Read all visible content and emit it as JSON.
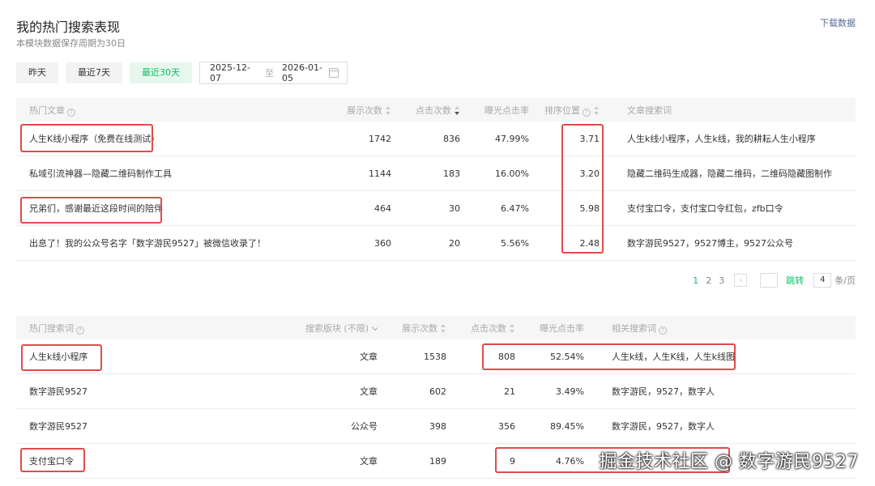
{
  "header": {
    "title": "我的热门搜索表现",
    "subtitle": "本模块数据保存周期为30日",
    "download": "下载数据"
  },
  "filters": {
    "yesterday": "昨天",
    "last7": "最近7天",
    "last30": "最近30天",
    "start_date": "2025-12-07",
    "to": "至",
    "end_date": "2026-01-05"
  },
  "articles_table": {
    "headers": [
      "热门文章",
      "展示次数",
      "点击次数",
      "曝光点击率",
      "排序位置",
      "文章搜索词"
    ],
    "rows": [
      [
        "人生K线小程序（免费在线测试）",
        "1742",
        "836",
        "47.99%",
        "3.71",
        "人生k线小程序，人生k线，我的耕耘人生小程序"
      ],
      [
        "私域引流神器—隐藏二维码制作工具",
        "1144",
        "183",
        "16.00%",
        "3.20",
        "隐藏二维码生成器，隐藏二维码，二维码隐藏图制作"
      ],
      [
        "兄弟们，感谢最近这段时间的陪伴",
        "464",
        "30",
        "6.47%",
        "5.98",
        "支付宝口令，支付宝口令红包，zfb口令"
      ],
      [
        "出息了！我的公众号名字「数字游民9527」被微信收录了！",
        "360",
        "20",
        "5.56%",
        "2.48",
        "数字游民9527，9527博主，9527公众号"
      ]
    ]
  },
  "pagination": {
    "pages": [
      "1",
      "2",
      "3"
    ],
    "next": "›",
    "jump": "跳转",
    "page_size": "4",
    "unit": "条/页"
  },
  "keywords_table": {
    "headers": [
      "热门搜索词",
      "搜索版块 (不限)",
      "展示次数",
      "点击次数",
      "曝光点击率",
      "相关搜索词"
    ],
    "rows": [
      [
        "人生k线小程序",
        "文章",
        "1538",
        "808",
        "52.54%",
        "人生k线，人生K线，人生k线图"
      ],
      [
        "数字游民9527",
        "文章",
        "602",
        "21",
        "3.49%",
        "数字游民，9527，数字人"
      ],
      [
        "数字游民9527",
        "公众号",
        "398",
        "356",
        "89.45%",
        "数字游民，9527，数字人"
      ],
      [
        "支付宝口令",
        "文章",
        "189",
        "9",
        "4.76%",
        ""
      ]
    ]
  },
  "watermark": "掘金技术社区 @ 数字游民9527",
  "colors": {
    "accent": "#07c160",
    "highlight": "#e04b4b",
    "link": "#576b95"
  }
}
